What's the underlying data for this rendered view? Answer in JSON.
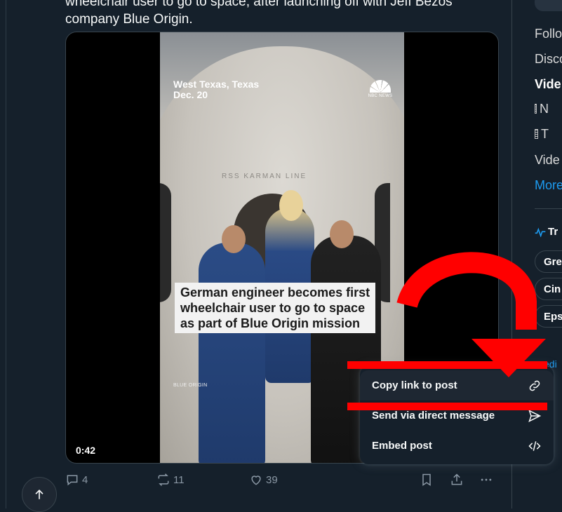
{
  "post": {
    "text_line1": "wheelchair user to go to space, after launching off with Jeff Bezos'",
    "text_line2": "company Blue Origin."
  },
  "video": {
    "location_line1": "West Texas, Texas",
    "location_line2": "Dec. 20",
    "network_logo": "NBC NEWS",
    "capsule_label": "RSS KARMAN LINE",
    "caption_line1": "German engineer becomes first",
    "caption_line2": "wheelchair user to go to space",
    "caption_line3": "as part of Blue Origin mission",
    "credit": "BLUE ORIGIN",
    "duration": "0:42"
  },
  "actions": {
    "replies": "4",
    "reposts": "11",
    "likes": "39"
  },
  "share_menu": {
    "items": [
      {
        "label": "Copy link to post",
        "icon": "link-icon"
      },
      {
        "label": "Send via direct message",
        "icon": "send-icon"
      },
      {
        "label": "Embed post",
        "icon": "code-icon"
      }
    ]
  },
  "sidebar": {
    "item1": "Follo",
    "item2": "Disco",
    "item3": "Vide",
    "doc1": "N",
    "doc2": "T",
    "item4": "Vide",
    "more": "More",
    "trending_label": "Tr",
    "chips": [
      "Gre",
      "Cin",
      "Eps"
    ],
    "partial_link": "edi"
  },
  "colors": {
    "background": "#15202b",
    "accent": "#1d9bf0",
    "annotation": "#ff0000"
  }
}
